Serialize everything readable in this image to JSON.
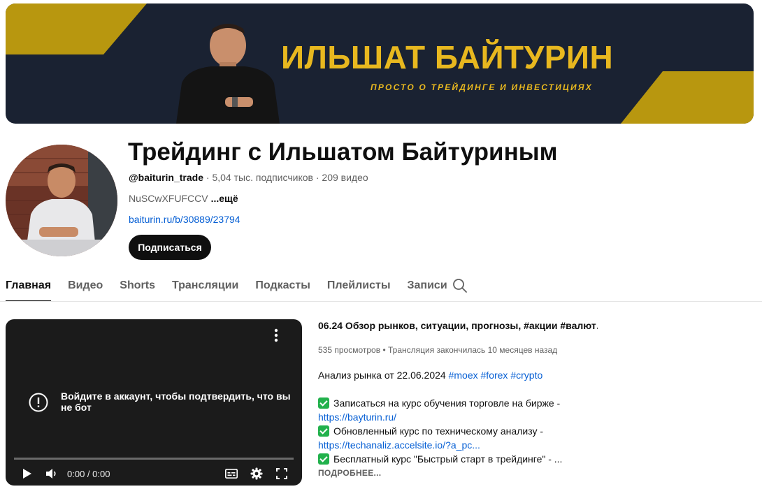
{
  "banner": {
    "title": "ИЛЬШАТ БАЙТУРИН",
    "subtitle": "ПРОСТО О ТРЕЙДИНГЕ И ИНВЕСТИЦИЯХ",
    "colors": {
      "background": "#1a2232",
      "accent": "#e8b81f"
    }
  },
  "channel": {
    "name": "Трейдинг с Ильшатом Байтуриным",
    "handle": "@baiturin_trade",
    "subscribers": "5,04 тыс. подписчиков",
    "videos": "209 видео",
    "description": "NuSCwXFUFCCV",
    "more_label": "...ещё",
    "link": "baiturin.ru/b/30889/23794",
    "subscribe_label": "Подписаться"
  },
  "tabs": [
    {
      "label": "Главная",
      "active": true
    },
    {
      "label": "Видео",
      "active": false
    },
    {
      "label": "Shorts",
      "active": false
    },
    {
      "label": "Трансляции",
      "active": false
    },
    {
      "label": "Подкасты",
      "active": false
    },
    {
      "label": "Плейлисты",
      "active": false
    },
    {
      "label": "Записи",
      "active": false
    }
  ],
  "player": {
    "message": "Войдите в аккаунт, чтобы подтвердить, что вы не бот",
    "time": "0:00 / 0:00",
    "icons": [
      "more-vert-icon",
      "warning-icon",
      "play-icon",
      "volume-icon",
      "subtitles-icon",
      "settings-icon",
      "fullscreen-icon"
    ]
  },
  "video": {
    "title": "06.24 Обзор рынков, ситуации, прогнозы, #акции #валют…",
    "views": "535 просмотров",
    "status": "Трансляция закончилась 10 месяцев назад",
    "desc_intro": "Анализ рынка от 22.06.2024",
    "tags": [
      "#moex",
      "#forex",
      "#crypto"
    ],
    "items": [
      {
        "text": "Записаться на курс  обучения  торговле на бирже -",
        "link": "https://bayturin.ru/"
      },
      {
        "text": "Обновленный курс по техническому анализу -",
        "link": "https://techanaliz.accelsite.io/?a_pc..."
      },
      {
        "text": "Бесплатный курс \"Быстрый старт в трейдинге\" - ...",
        "link": ""
      }
    ],
    "more_label": "ПОДРОБНЕЕ..."
  }
}
